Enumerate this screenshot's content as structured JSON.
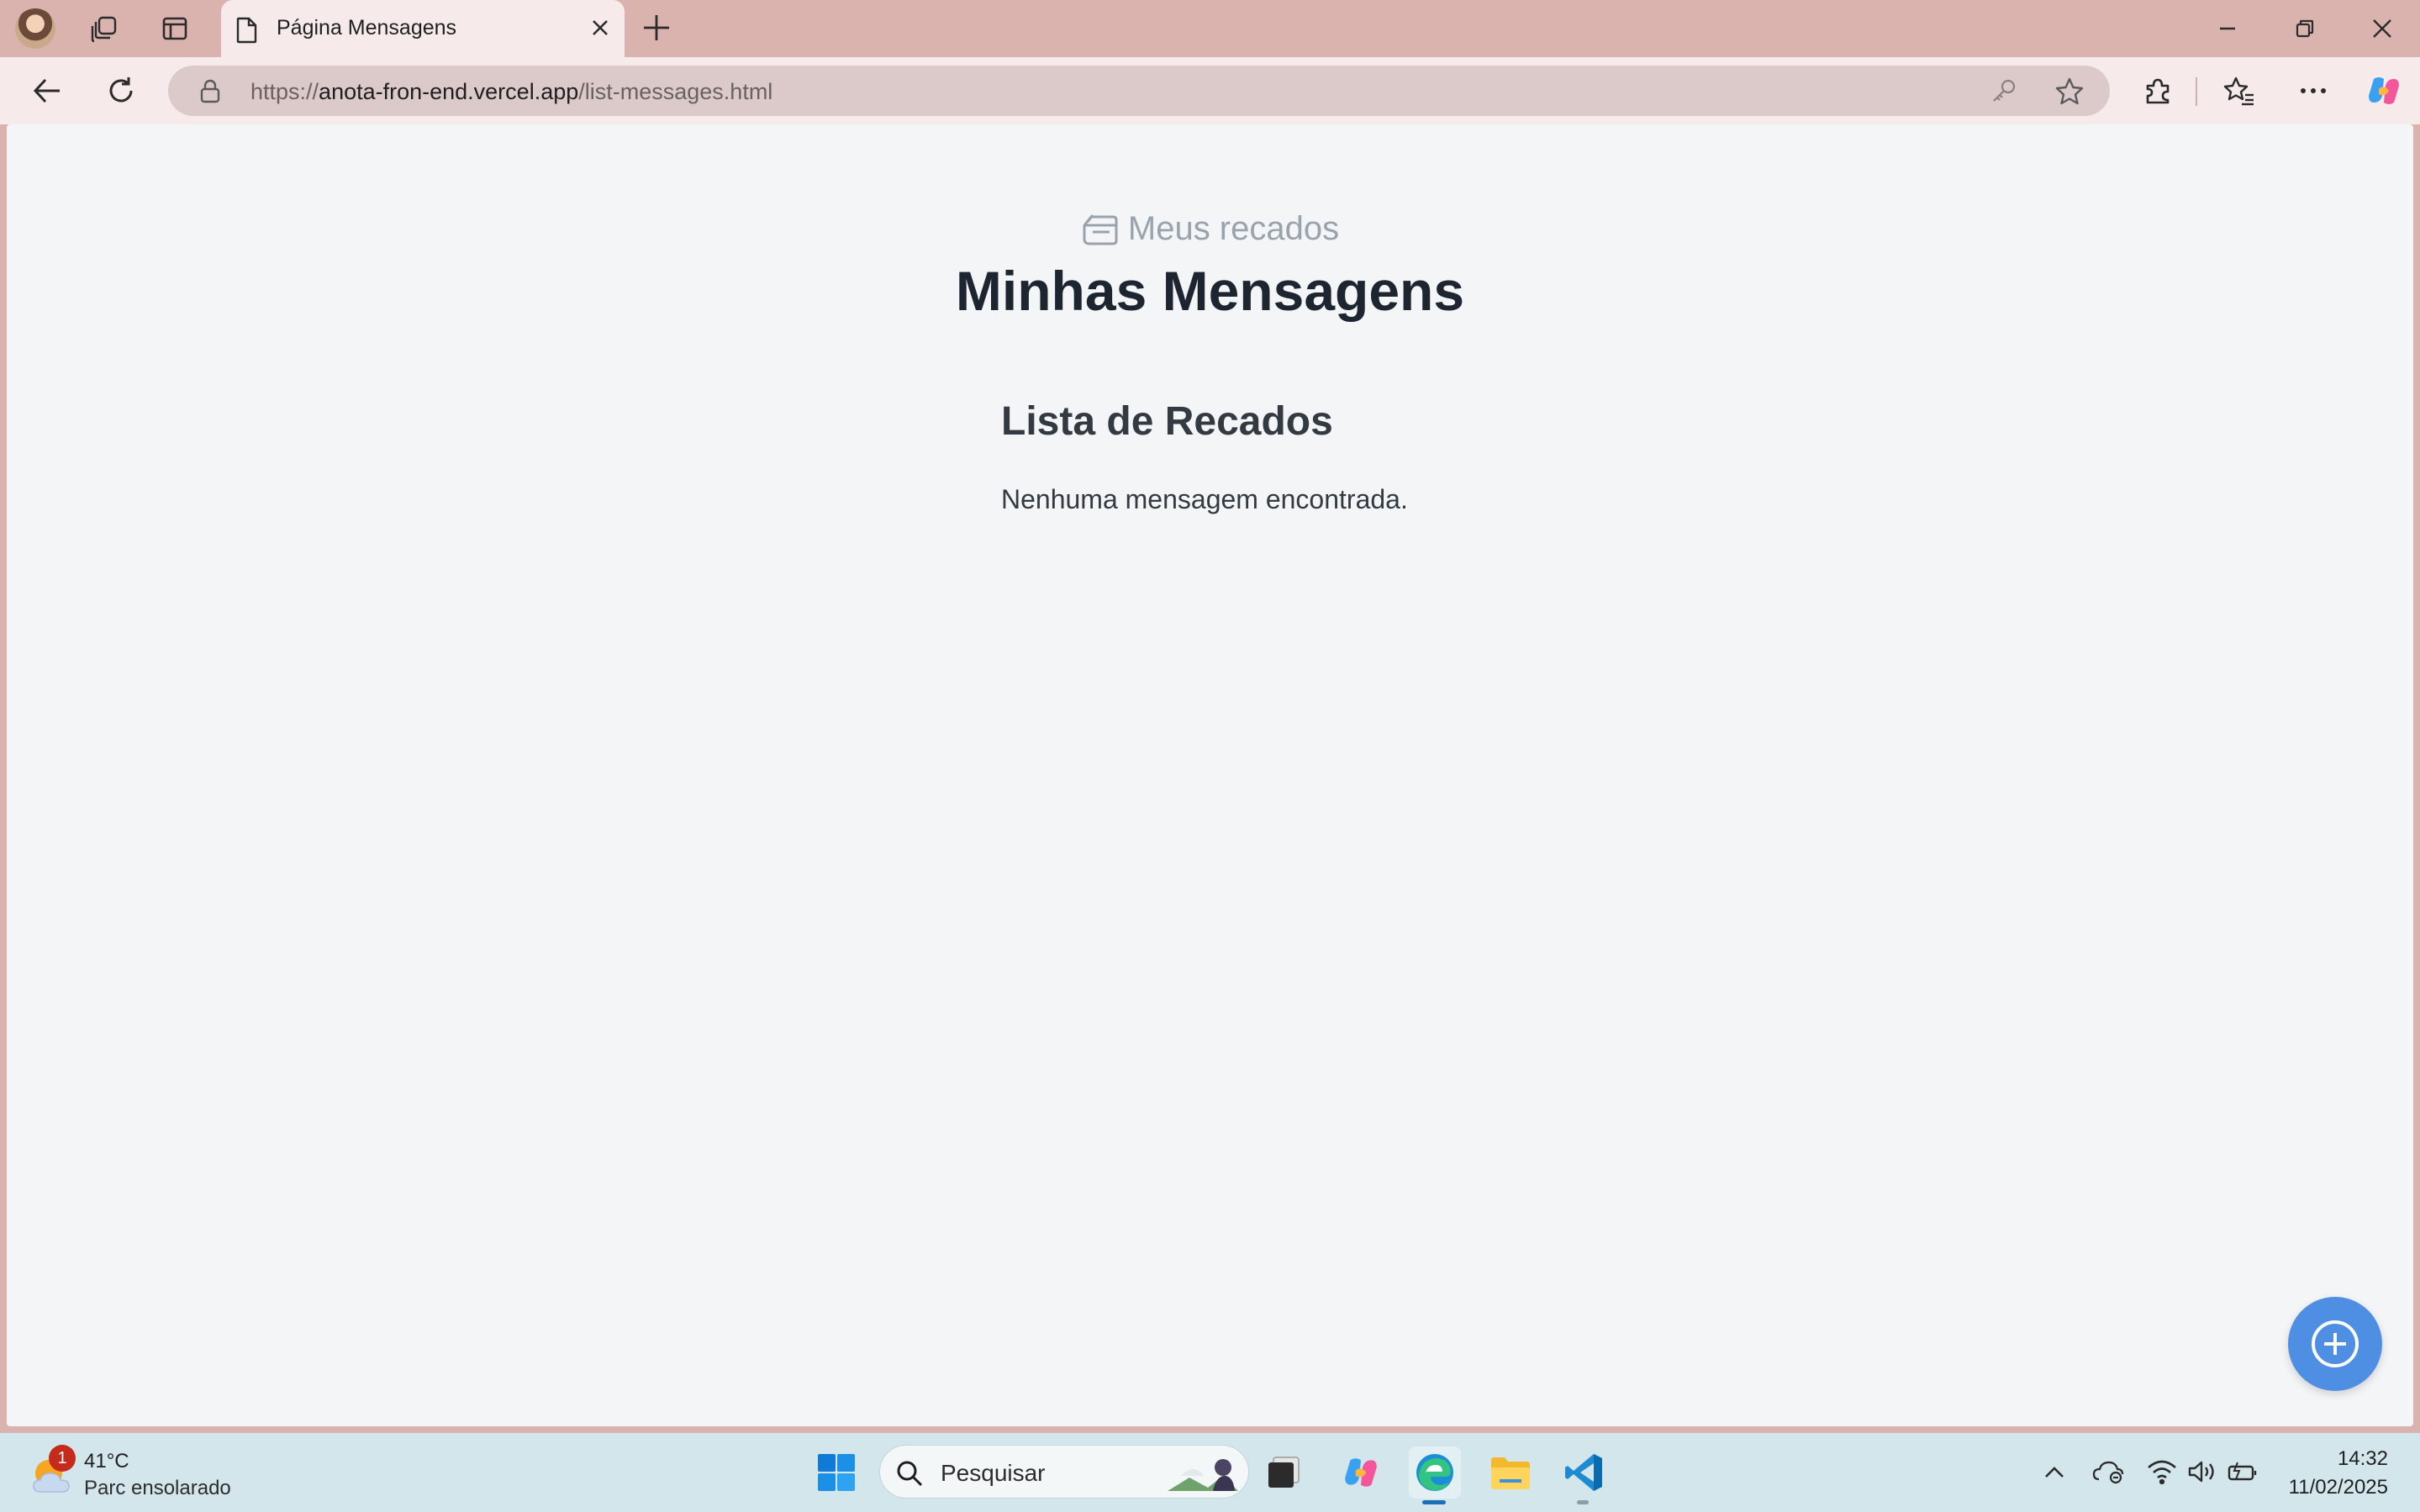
{
  "browser": {
    "tab": {
      "title": "Página Mensagens"
    },
    "url": {
      "scheme": "https://",
      "host": "anota-fron-end.vercel.app",
      "path": "/list-messages.html"
    },
    "icons": [
      "avatar",
      "workspaces-icon",
      "vertical-tabs-icon",
      "page-icon",
      "close-icon",
      "plus-icon",
      "minimize-icon",
      "restore-icon",
      "close-window-icon",
      "back-icon",
      "refresh-icon",
      "lock-icon",
      "key-icon",
      "star-icon",
      "extensions-icon",
      "favorites-icon",
      "more-icon",
      "copilot-icon"
    ]
  },
  "page": {
    "brand": {
      "label": "Meus recados",
      "icon": "message-box-icon"
    },
    "title": "Minhas Mensagens",
    "section_title": "Lista de Recados",
    "empty_message": "Nenhuma mensagem encontrada.",
    "fab_icon": "plus-circle-icon",
    "colors": {
      "background": "#f4f5f7",
      "fab": "#4f8fe3",
      "title": "#1c2530",
      "brand": "#9aa3ad"
    }
  },
  "taskbar": {
    "weather": {
      "badge": "1",
      "temperature": "41°C",
      "condition": "Parc ensolarado"
    },
    "search": {
      "placeholder": "Pesquisar"
    },
    "apps": [
      "windows-start-icon",
      "task-view-icon",
      "copilot-app-icon",
      "edge-icon",
      "file-explorer-icon",
      "vscode-icon"
    ],
    "tray_icons": [
      "chevron-up-icon",
      "onedrive-icon",
      "wifi-icon",
      "volume-icon",
      "battery-icon"
    ],
    "clock": {
      "time": "14:32",
      "date": "11/02/2025"
    }
  }
}
